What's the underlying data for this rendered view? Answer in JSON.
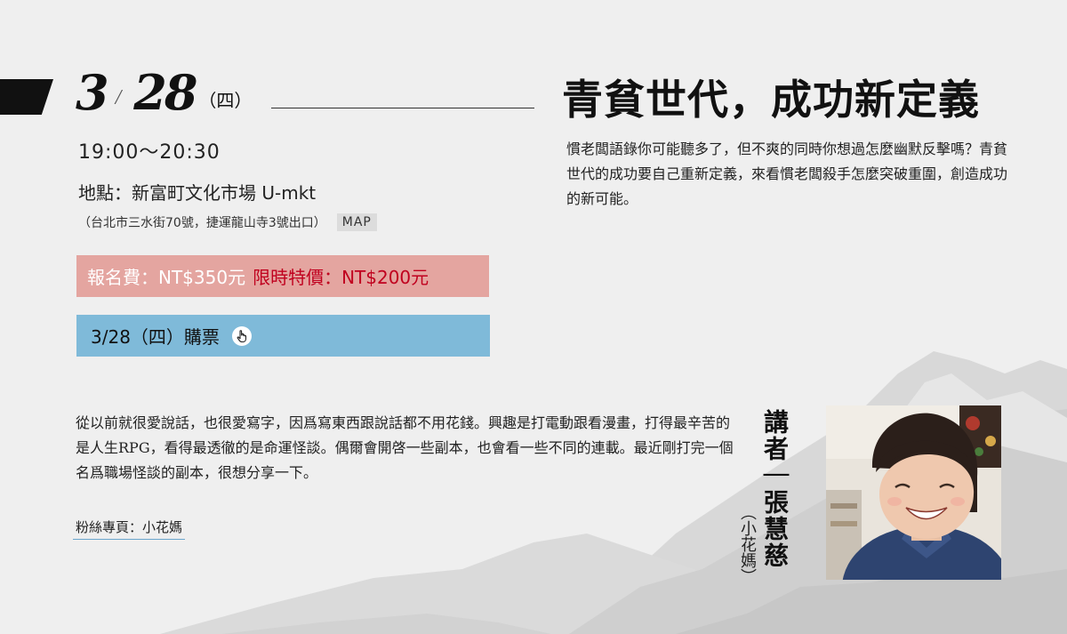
{
  "event": {
    "date_month": "3",
    "date_day": "28",
    "weekday": "（四）",
    "time": "19:00～20:30",
    "venue": "地點：新富町文化市場 U-mkt",
    "address": "（台北市三水街70號，捷運龍山寺3號出口）",
    "map_label": "MAP",
    "fee_regular": "報名費：NT$350元",
    "fee_promo": "限時特價：NT$200元",
    "ticket_label": "3/28（四）購票"
  },
  "talk": {
    "title": "青貧世代，成功新定義",
    "description": "慣老闆語錄你可能聽多了，但不爽的同時你想過怎麼幽默反擊嗎？青貧世代的成功要自己重新定義，來看慣老闆殺手怎麼突破重圍，創造成功的新可能。"
  },
  "speaker": {
    "bio": "從以前就很愛說話，也很愛寫字，因爲寫東西跟說話都不用花錢。興趣是打電動跟看漫畫，打得最辛苦的是人生RPG，看得最透徹的是命運怪談。偶爾會開啓一些副本，也會看一些不同的連載。最近剛打完一個名爲職場怪談的副本，很想分享一下。",
    "fanpage": "粉絲專頁：小花媽",
    "label": "講者｜張慧慈",
    "nickname": "（小花媽）"
  },
  "colors": {
    "background": "#efefef",
    "fee_bar": "#e4a5a0",
    "promo_text": "#c0001e",
    "ticket_bar": "#7fbad9",
    "accent_dark": "#111111"
  },
  "icons": {
    "ticket": "hand-pointer-icon"
  }
}
